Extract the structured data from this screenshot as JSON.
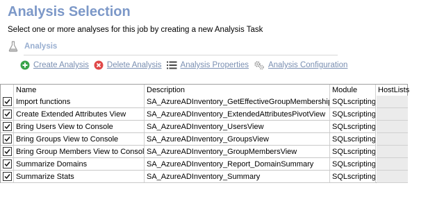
{
  "header": {
    "title": "Analysis Selection",
    "subtitle": "Select one or more analyses for this job by creating a new Analysis Task"
  },
  "section": {
    "label": "Analysis"
  },
  "toolbar": {
    "create": "Create Analysis",
    "delete": "Delete Analysis",
    "properties": "Analysis Properties",
    "configuration": "Analysis Configuration"
  },
  "grid": {
    "columns": {
      "name": "Name",
      "description": "Description",
      "module": "Module",
      "hostlists": "HostLists"
    },
    "rows": [
      {
        "checked": true,
        "name": "Import functions",
        "description": "SA_AzureADInventory_GetEffectiveGroupMembership",
        "module": "SQLscripting",
        "hostlists": ""
      },
      {
        "checked": true,
        "name": "Create Extended Attributes View",
        "description": "SA_AzureADInventory_ExtendedAttributesPivotView",
        "module": "SQLscripting",
        "hostlists": ""
      },
      {
        "checked": true,
        "name": "Bring Users View to Console",
        "description": "SA_AzureADInventory_UsersView",
        "module": "SQLscripting",
        "hostlists": ""
      },
      {
        "checked": true,
        "name": "Bring Groups View to Console",
        "description": "SA_AzureADInventory_GroupsView",
        "module": "SQLscripting",
        "hostlists": ""
      },
      {
        "checked": true,
        "name": "Bring Group Members View to Console",
        "description": "SA_AzureADInventory_GroupMembersView",
        "module": "SQLscripting",
        "hostlists": ""
      },
      {
        "checked": true,
        "name": "Summarize Domains",
        "description": "SA_AzureADInventory_Report_DomainSummary",
        "module": "SQLscripting",
        "hostlists": ""
      },
      {
        "checked": true,
        "name": "Summarize Stats",
        "description": "SA_AzureADInventory_Summary",
        "module": "SQLscripting",
        "hostlists": ""
      }
    ]
  },
  "icons": {
    "section": "flask-icon",
    "create": "plus-circle-icon",
    "delete": "x-circle-icon",
    "properties": "list-icon",
    "configuration": "gears-icon"
  },
  "colors": {
    "title": "#7c98c8",
    "link": "#7a8fb2",
    "create_icon": "#3aa44a",
    "delete_icon": "#e04848"
  }
}
